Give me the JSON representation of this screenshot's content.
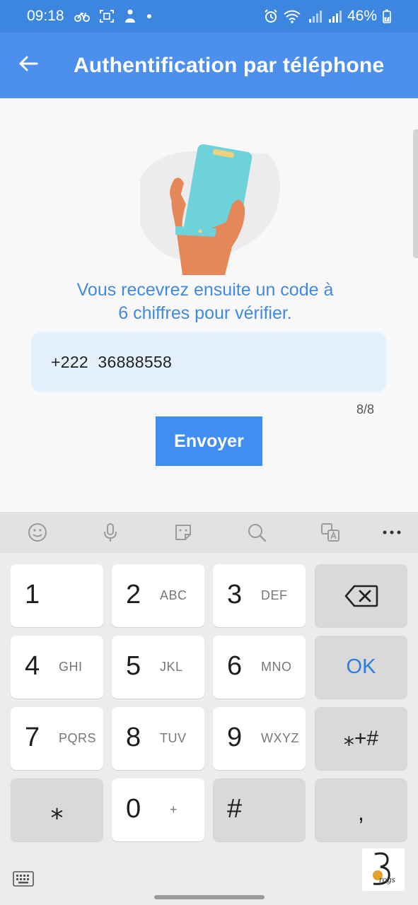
{
  "status_bar": {
    "time": "09:18",
    "battery": "46%",
    "icons": [
      "bike-icon",
      "scan-icon",
      "person-icon",
      "dot-icon",
      "alarm-icon",
      "wifi-icon",
      "signal-icon",
      "signal-icon",
      "battery-icon"
    ]
  },
  "app_bar": {
    "title": "Authentification par téléphone",
    "back_icon": "arrow-back-icon"
  },
  "main": {
    "instruction_line1": "Vous recevrez ensuite un code à",
    "instruction_line2": "6 chiffres pour vérifier.",
    "phone_value": "+222  36888558",
    "counter": "8/8",
    "send_label": "Envoyer"
  },
  "keyboard": {
    "toolbar_icons": [
      "emoji-icon",
      "microphone-icon",
      "sticker-icon",
      "search-icon",
      "translate-icon",
      "more-icon"
    ],
    "keys": [
      {
        "main": "1",
        "sub": ""
      },
      {
        "main": "2",
        "sub": "ABC"
      },
      {
        "main": "3",
        "sub": "DEF"
      },
      {
        "main": "4",
        "sub": "GHI"
      },
      {
        "main": "5",
        "sub": "JKL"
      },
      {
        "main": "6",
        "sub": "MNO"
      },
      {
        "main": "7",
        "sub": "PQRS"
      },
      {
        "main": "8",
        "sub": "TUV"
      },
      {
        "main": "9",
        "sub": "WXYZ"
      },
      {
        "main": "0",
        "sub": "+"
      }
    ],
    "ok_label": "OK",
    "symbols_label": "⁎+#",
    "star_label": "⁎",
    "hash_label": "#",
    "comma_label": ",",
    "logo_text": "Progs"
  },
  "colors": {
    "accent": "#4c8fec",
    "status_bar": "#3d86e0",
    "field_bg": "#e4f0fb",
    "button": "#3f8ef0"
  }
}
